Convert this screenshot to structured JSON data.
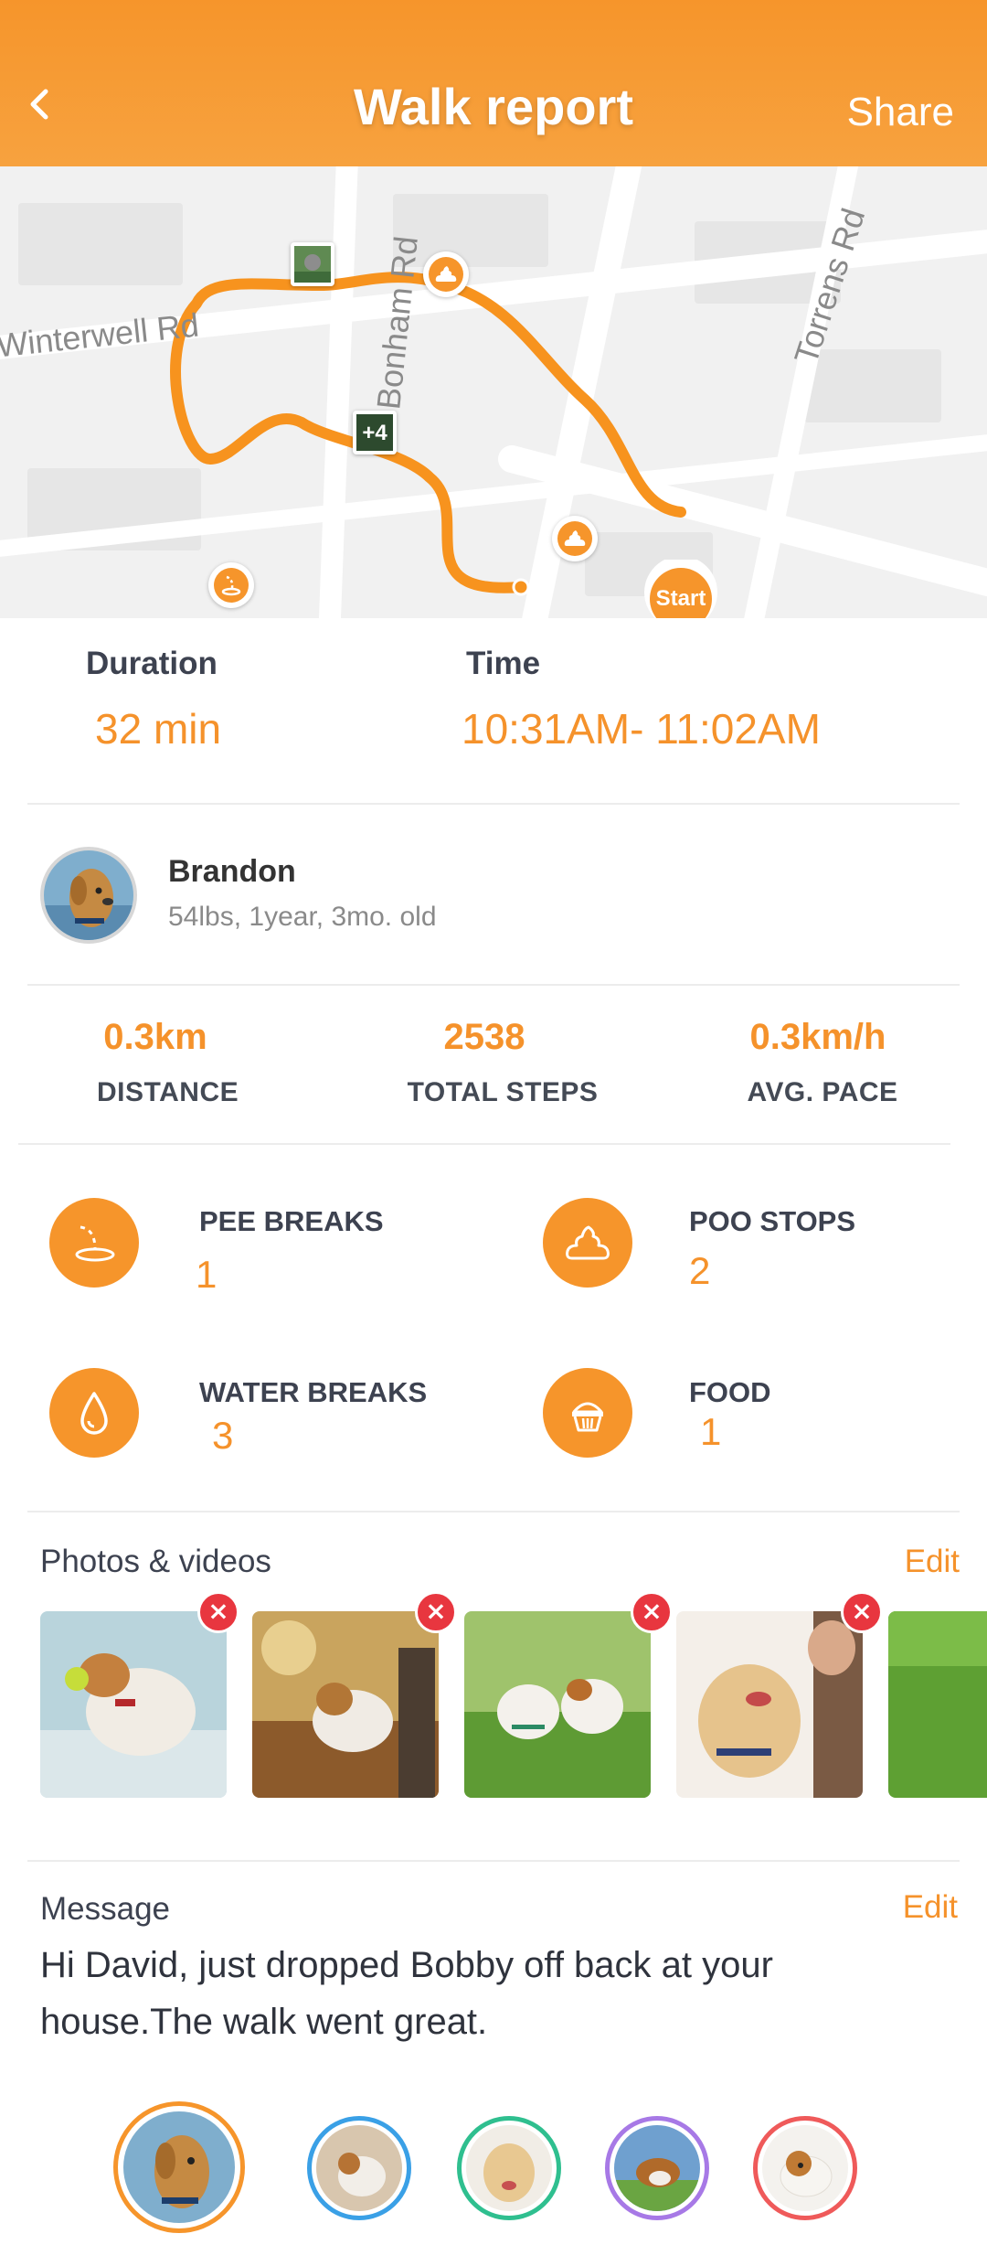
{
  "header": {
    "title": "Walk report",
    "share_label": "Share",
    "back_icon": "chevron-left-icon",
    "background": "#f6952b"
  },
  "map": {
    "streets": [
      "Winterwell Rd",
      "Bonham Rd",
      "Torrens Rd"
    ],
    "start_label": "Start",
    "photo_cluster_label": "+4",
    "route_color": "#f7931e"
  },
  "summary": {
    "duration_label": "Duration",
    "duration_value": "32 min",
    "time_label": "Time",
    "time_value": "10:31AM- 11:02AM"
  },
  "dog": {
    "name": "Brandon",
    "details": "54lbs, 1year, 3mo. old"
  },
  "metrics": [
    {
      "value": "0.3km",
      "label": "DISTANCE"
    },
    {
      "value": "2538",
      "label": "TOTAL STEPS"
    },
    {
      "value": "0.3km/h",
      "label": "AVG. PACE"
    }
  ],
  "activities": [
    {
      "icon": "pee-icon",
      "label": "PEE BREAKS",
      "value": "1"
    },
    {
      "icon": "poo-icon",
      "label": "POO STOPS",
      "value": "2"
    },
    {
      "icon": "water-drop-icon",
      "label": "WATER BREAKS",
      "value": "3"
    },
    {
      "icon": "food-bowl-icon",
      "label": "FOOD",
      "value": "1"
    }
  ],
  "photos": {
    "title": "Photos & videos",
    "edit_label": "Edit",
    "remove_icon": "close-icon"
  },
  "message": {
    "title": "Message",
    "edit_label": "Edit",
    "text": "Hi David, just dropped Bobby off back at your house.The walk went great."
  },
  "colors": {
    "accent": "#f5922b",
    "remove": "#e8363f",
    "tab_rings": [
      "#f6952b",
      "#3aa0e6",
      "#2fbf8f",
      "#a779e6",
      "#ef5a5a"
    ]
  }
}
